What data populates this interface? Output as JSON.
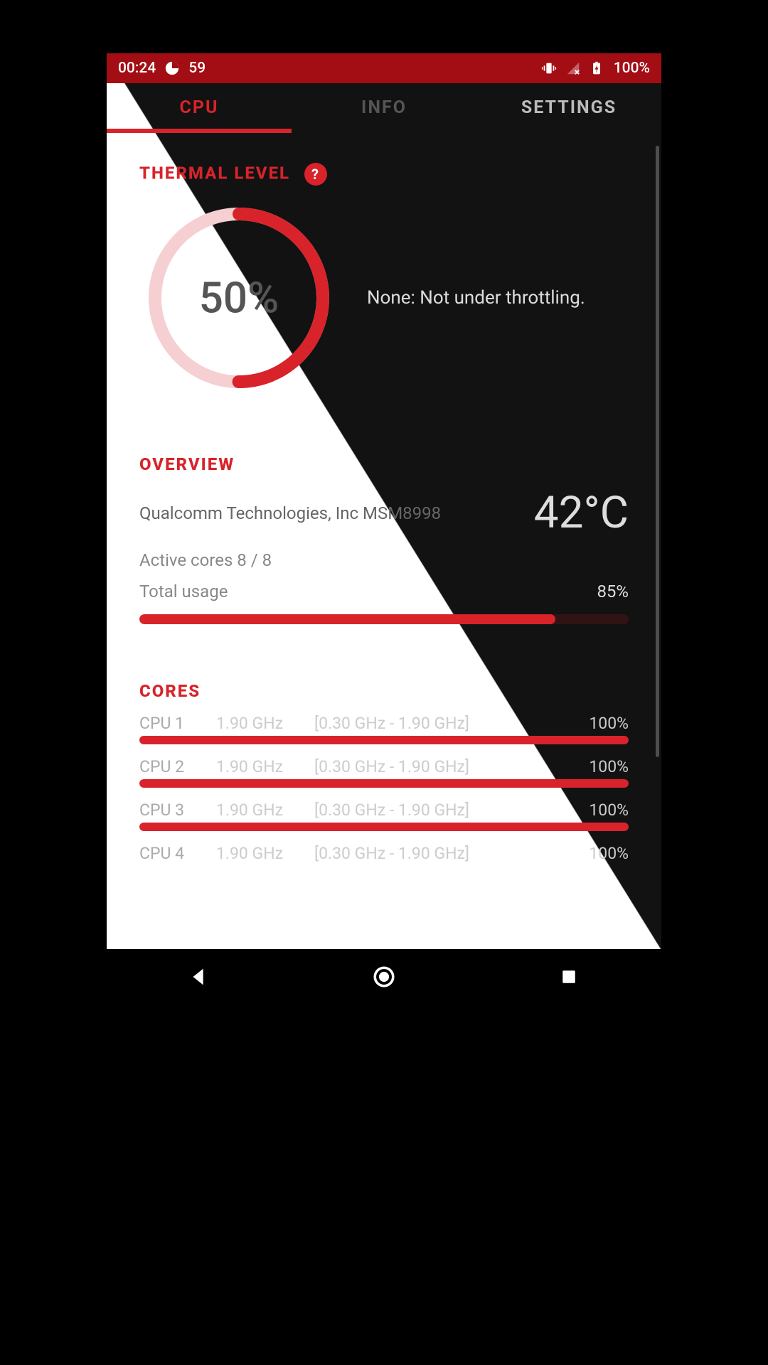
{
  "statusbar": {
    "time": "00:24",
    "notif_count": "59",
    "battery_pct": "100%"
  },
  "tabs": {
    "cpu": "CPU",
    "info": "INFO",
    "settings": "SETTINGS"
  },
  "thermal": {
    "title": "THERMAL LEVEL",
    "help": "?",
    "percent_label": "50%",
    "status_text": "None: Not under throttling."
  },
  "overview": {
    "title": "OVERVIEW",
    "chip": "Qualcomm Technologies, Inc MSM8998",
    "temp": "42°C",
    "active_cores": "Active cores 8 / 8",
    "total_usage_label": "Total usage",
    "total_usage_pct": "85%"
  },
  "cores": {
    "title": "CORES",
    "rows": [
      {
        "name": "CPU 1",
        "freq": "1.90 GHz",
        "range": "[0.30 GHz - 1.90 GHz]",
        "pct": "100%"
      },
      {
        "name": "CPU 2",
        "freq": "1.90 GHz",
        "range": "[0.30 GHz - 1.90 GHz]",
        "pct": "100%"
      },
      {
        "name": "CPU 3",
        "freq": "1.90 GHz",
        "range": "[0.30 GHz - 1.90 GHz]",
        "pct": "100%"
      },
      {
        "name": "CPU 4",
        "freq": "1.90 GHz",
        "range": "[0.30 GHz - 1.90 GHz]",
        "pct": "100%"
      }
    ]
  },
  "chart_data": {
    "thermal_gauge": {
      "type": "pie",
      "value": 50,
      "max": 100,
      "title": "Thermal Level"
    },
    "total_usage_bar": {
      "type": "bar",
      "value": 85,
      "max": 100,
      "title": "Total usage"
    },
    "cores_bars": {
      "type": "bar",
      "categories": [
        "CPU 1",
        "CPU 2",
        "CPU 3",
        "CPU 4"
      ],
      "values": [
        100,
        100,
        100,
        100
      ],
      "title": "Core usage %",
      "ylim": [
        0,
        100
      ]
    }
  }
}
